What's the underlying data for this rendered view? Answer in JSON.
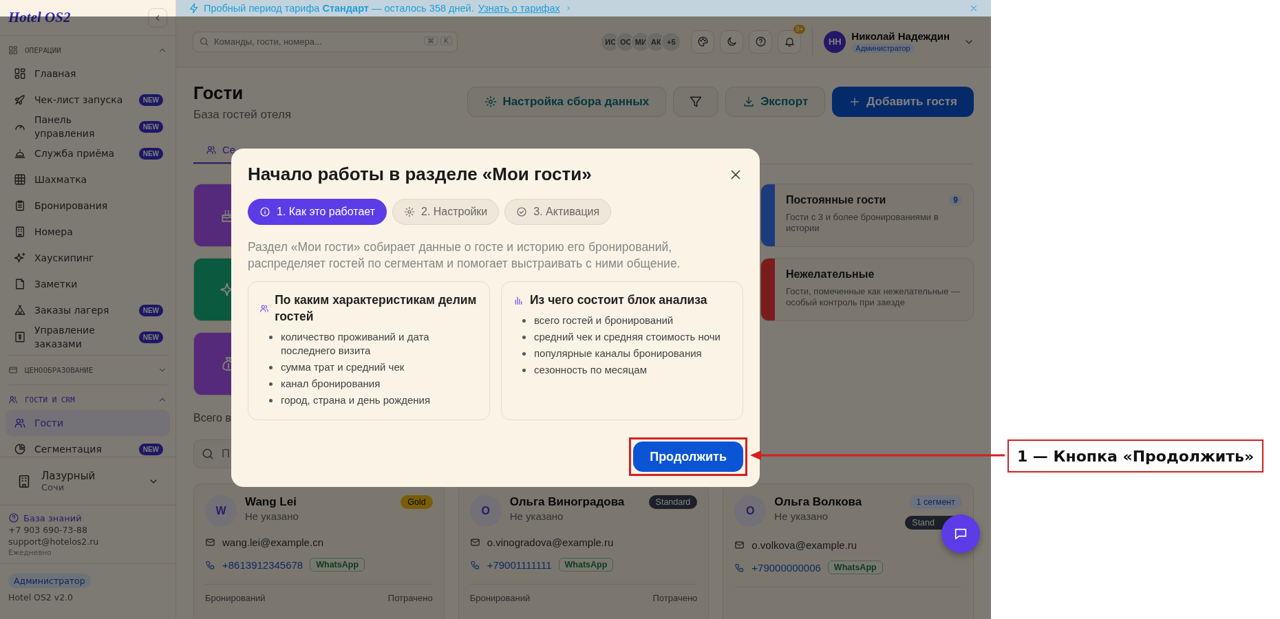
{
  "banner": {
    "text": "Пробный период тарифа **Стандарт** — осталось 358 дней.",
    "link": "Узнать о тарифах"
  },
  "sidebar": {
    "logo": "Hotel OS2",
    "sections": [
      {
        "title": "ОПЕРАЦИИ",
        "expanded": true,
        "items": [
          {
            "label": "Главная",
            "selected": false
          },
          {
            "label": "Чек-лист запуска",
            "badge": "NEW",
            "selected": false
          },
          {
            "label": "Панель управления",
            "badge": "NEW",
            "selected": false
          },
          {
            "label": "Служба приёма",
            "badge": "NEW",
            "selected": false
          },
          {
            "label": "Шахматка",
            "selected": false
          },
          {
            "label": "Бронирования",
            "selected": false
          },
          {
            "label": "Номера",
            "selected": false
          },
          {
            "label": "Хаускипинг",
            "selected": false
          },
          {
            "label": "Заметки",
            "selected": false
          },
          {
            "label": "Заказы лагеря",
            "badge": "NEW",
            "selected": false
          },
          {
            "label": "Управление заказами",
            "badge": "NEW",
            "selected": false
          }
        ]
      },
      {
        "title": "ЦЕНООБРАЗОВАНИЕ",
        "expanded": false
      },
      {
        "title": "ГОСТИ И CRM",
        "expanded": true,
        "items": [
          {
            "label": "Гости",
            "selected": true
          },
          {
            "label": "Сегментация",
            "badge": "NEW",
            "selected": false
          }
        ]
      }
    ],
    "hotel": {
      "name": "Лазурный",
      "city": "Сочи"
    },
    "help": {
      "link": "База знаний",
      "phone": "+7 903 690-73-88",
      "email": "support@hotelos2.ru",
      "hours": "Ежедневно"
    },
    "role": "Администратор",
    "version": "Hotel OS2 v2.0"
  },
  "topbar": {
    "search_placeholder": "Команды, гости, номера...",
    "keys": [
      "⌘",
      "K"
    ],
    "team": [
      "ИС",
      "ОС",
      "МИ",
      "АК",
      "+5"
    ],
    "notifications": "9+",
    "user": {
      "initials": "НН",
      "name": "Николай Надеждин",
      "role": "Администратор"
    }
  },
  "page": {
    "title": "Гости",
    "subtitle": "База гостей отеля",
    "actions": [
      {
        "kind": "secondary",
        "label": "Настройка сбора данных"
      },
      {
        "kind": "icon"
      },
      {
        "kind": "secondary",
        "label": "Экспорт"
      },
      {
        "kind": "primary",
        "label": "Добавить гостя"
      }
    ],
    "tabs": [
      {
        "label": "Се",
        "selected": true
      }
    ],
    "segments_left": [
      {
        "color": "#552a7a"
      },
      {
        "color": "#0b5a40"
      },
      {
        "color": "#552a7a"
      }
    ],
    "segments_right": [
      {
        "color": "#1d3a7c",
        "title": "Постоянные гости",
        "description": "Гости с 3 и более бронированиями в истории",
        "count": "9"
      },
      {
        "color": "#7a1c1c",
        "title": "Нежелательные",
        "description": "Гости, помеченные как нежелательные — особый контроль при заезде"
      }
    ],
    "total_text": "Всего в",
    "search_placeholder": "П",
    "guests": [
      {
        "initial": "W",
        "name": "Wang Lei",
        "note": "Не указано",
        "tags": [
          {
            "label": "Gold",
            "kind": "gold"
          }
        ],
        "email": "wang.lei@example.cn",
        "phone": "+8613912345678",
        "messenger": "WhatsApp",
        "bookings_label": "Бронирований",
        "spent_label": "Потрачено"
      },
      {
        "initial": "О",
        "name": "Ольга Виноградова",
        "note": "Не указано",
        "tags": [
          {
            "label": "Standard",
            "kind": "standard"
          }
        ],
        "email": "o.vinogradova@example.ru",
        "phone": "+79001111111",
        "messenger": "WhatsApp",
        "bookings_label": "Бронирований",
        "spent_label": "Потрачено"
      },
      {
        "initial": "О",
        "name": "Ольга Волкова",
        "note": "Не указано",
        "tags": [
          {
            "label": "1 сегмент",
            "kind": "segment"
          },
          {
            "label": "Stand",
            "kind": "standard"
          }
        ],
        "email": "o.volkova@example.ru",
        "phone": "+79000000006",
        "messenger": "WhatsApp"
      }
    ]
  },
  "modal": {
    "title": "Начало работы в разделе «Мои гости»",
    "steps": [
      {
        "label": "1. Как это работает",
        "selected": true
      },
      {
        "label": "2. Настройки",
        "selected": false
      },
      {
        "label": "3. Активация",
        "selected": false
      }
    ],
    "intro": "Раздел «Мои гости» собирает данные о госте и историю его бронирований, распределяет гостей по сегментам и помогает выстраивать с ними общение.",
    "blocks": [
      {
        "title": "По каким характеристикам делим гостей",
        "items": [
          "количество проживаний и дата последнего визита",
          "сумма трат и средний чек",
          "канал бронирования",
          "город, страна и день рождения"
        ]
      },
      {
        "title": "Из чего состоит блок анализа",
        "items": [
          "всего гостей и бронирований",
          "средний чек и средняя стоимость ночи",
          "популярные каналы бронирования",
          "сезонность по месяцам"
        ]
      }
    ],
    "button": "Продолжить"
  },
  "annotations": [
    {
      "label": "1 — Кнопка «Продолжить»"
    }
  ]
}
